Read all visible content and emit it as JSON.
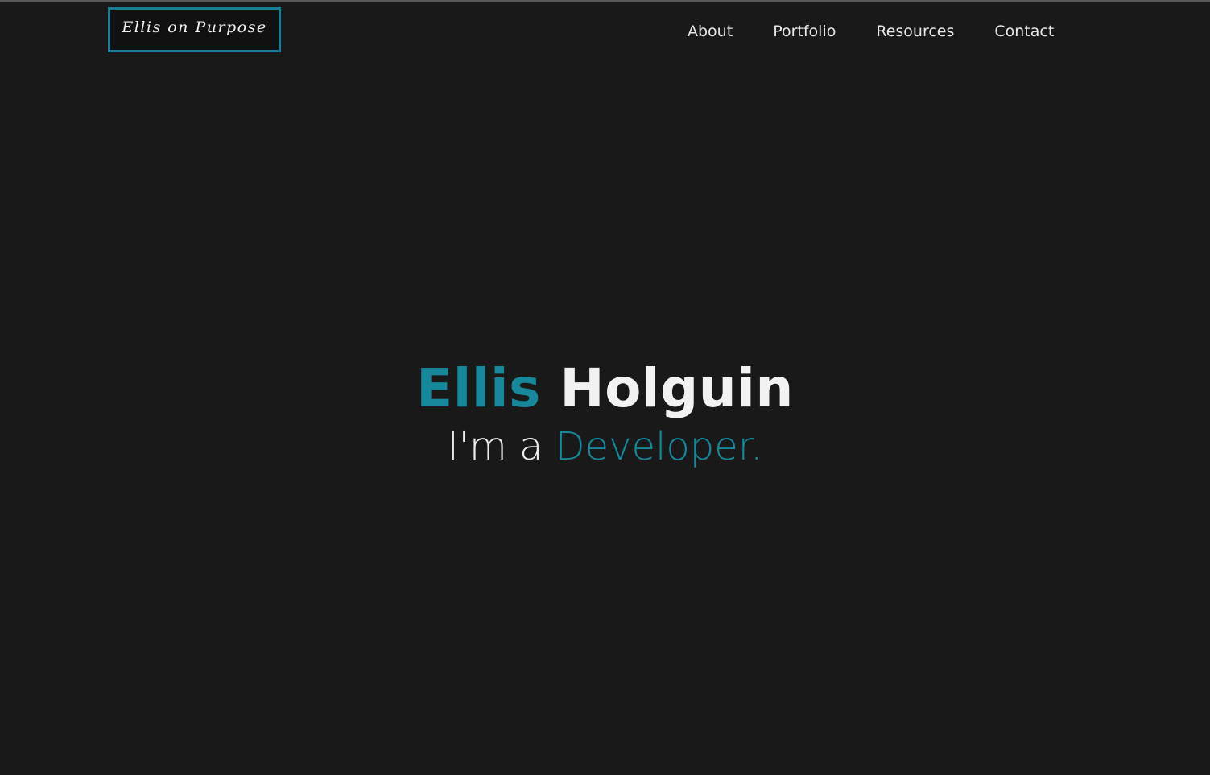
{
  "header": {
    "logo_text": "Ellis on Purpose",
    "nav": [
      {
        "label": "About"
      },
      {
        "label": "Portfolio"
      },
      {
        "label": "Resources"
      },
      {
        "label": "Contact"
      }
    ]
  },
  "hero": {
    "first_name": "Ellis",
    "last_name": "Holguin",
    "tagline_prefix": "I'm a",
    "tagline_role": "Developer."
  },
  "colors": {
    "background": "#191919",
    "accent": "#17879c",
    "text": "#f2f2f2"
  }
}
